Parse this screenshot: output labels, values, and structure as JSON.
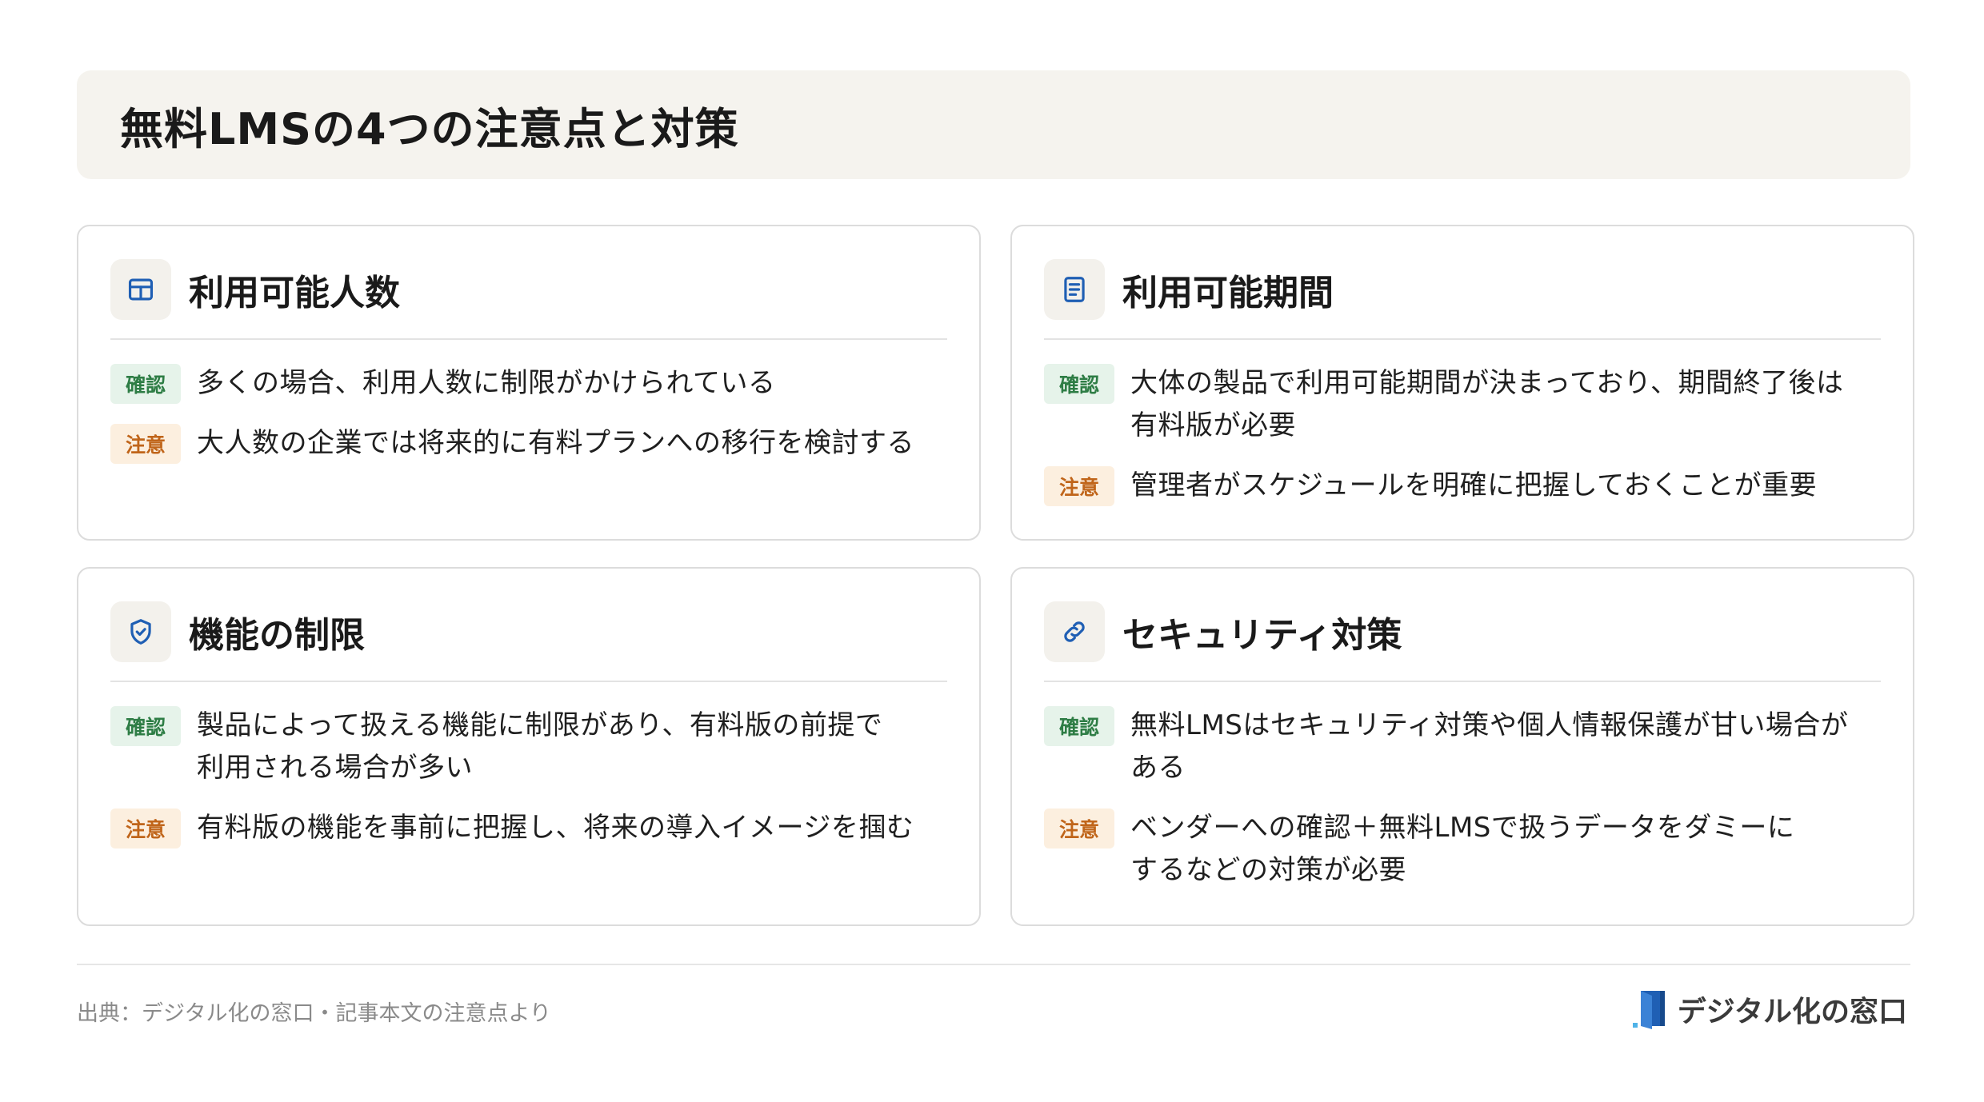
{
  "title": "無料LMSの4つの注意点と対策",
  "colors": {
    "accent_blue": "#1f5fb4",
    "confirm_badge": "#2e7d45",
    "caution_badge": "#c0651a",
    "title_bg": "#f5f3ee"
  },
  "cards": [
    {
      "icon": "table-icon",
      "title": "利用可能人数",
      "confirm_label": "確認",
      "confirm_lines": [
        "多くの場合、利用人数に制限がかけられている"
      ],
      "caution_label": "注意",
      "caution_lines": [
        "大人数の企業では将来的に有料プランへの移行を検討する"
      ]
    },
    {
      "icon": "document-icon",
      "title": "利用可能期間",
      "confirm_label": "確認",
      "confirm_lines": [
        "大体の製品で利用可能期間が決まっており、期間終了後は",
        "有料版が必要"
      ],
      "caution_label": "注意",
      "caution_lines": [
        "管理者がスケジュールを明確に把握しておくことが重要"
      ]
    },
    {
      "icon": "shield-check-icon",
      "title": "機能の制限",
      "confirm_label": "確認",
      "confirm_lines": [
        "製品によって扱える機能に制限があり、有料版の前提で",
        "利用される場合が多い"
      ],
      "caution_label": "注意",
      "caution_lines": [
        "有料版の機能を事前に把握し、将来の導入イメージを掴む"
      ]
    },
    {
      "icon": "link-icon",
      "title": "セキュリティ対策",
      "confirm_label": "確認",
      "confirm_lines": [
        "無料LMSはセキュリティ対策や個人情報保護が甘い場合が",
        "ある"
      ],
      "caution_label": "注意",
      "caution_lines": [
        "ベンダーへの確認＋無料LMSで扱うデータをダミーに",
        "するなどの対策が必要"
      ]
    }
  ],
  "footer": {
    "source": "出典：デジタル化の窓口・記事本文の注意点より",
    "brand": "デジタル化の窓口",
    "brand_icon": "door-logo-icon"
  }
}
